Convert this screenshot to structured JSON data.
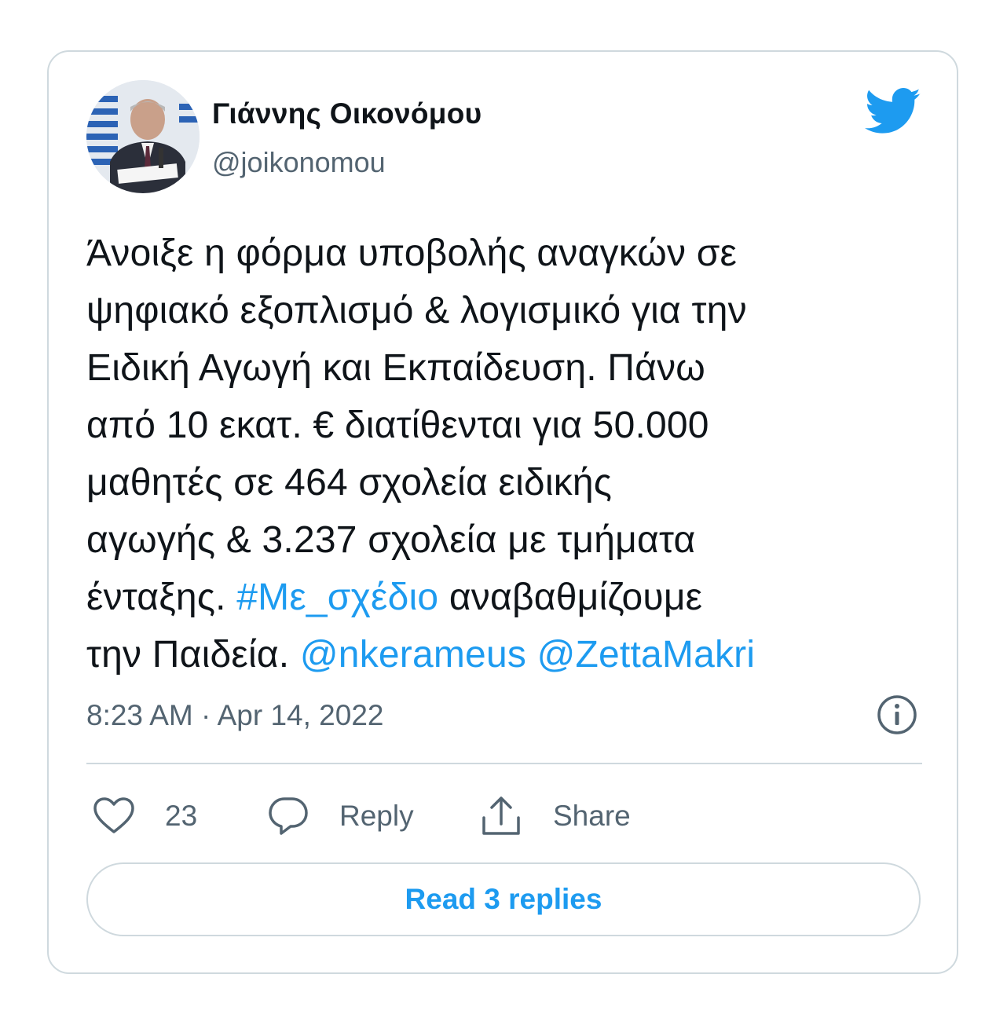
{
  "author": {
    "name": "Γιάννης Οικονόμου",
    "handle": "@joikonomou",
    "avatar_icon": "avatar-photo"
  },
  "brand": {
    "icon": "twitter-bird-icon",
    "color": "#1d9bf0"
  },
  "tweet": {
    "text_part1": "Άνοιξε η φόρμα υποβολής αναγκών σε\nψηφιακό εξοπλισμό & λογισμικό για την\nΕιδική Αγωγή και Εκπαίδευση. Πάνω\nαπό 10 εκατ. € διατίθενται για 50.000\nμαθητές σε 464 σχολεία ειδικής\nαγωγής & 3.237 σχολεία με τμήματα\nένταξης. ",
    "hashtag": "#Με_σχέδιο",
    "text_part2": " αναβαθμίζουμε\nτην Παιδεία. ",
    "mention1": "@nkerameus",
    "mention2": "@ZettaMakri",
    "timestamp": "8:23 AM · Apr 14, 2022"
  },
  "actions": {
    "like_count": "23",
    "reply_label": "Reply",
    "share_label": "Share"
  },
  "read_replies_label": "Read 3 replies",
  "colors": {
    "link": "#1d9bf0",
    "muted": "#536471",
    "border": "#cfd9de",
    "text": "#0f1419"
  }
}
